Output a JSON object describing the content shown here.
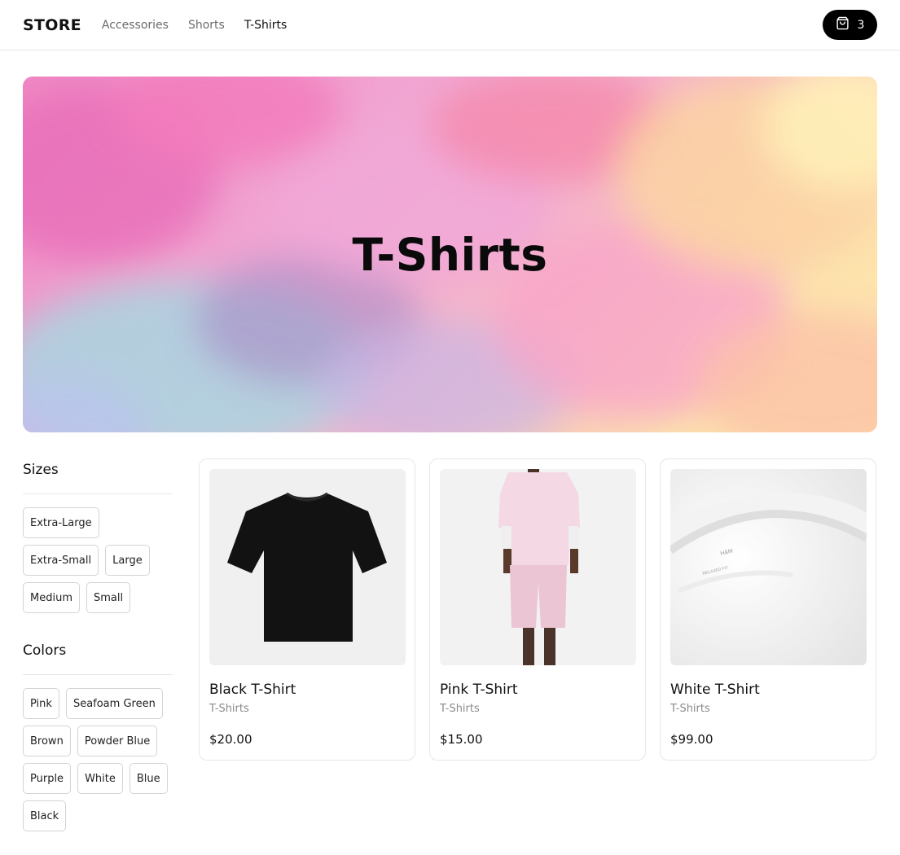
{
  "header": {
    "logo": "STORE",
    "nav": [
      {
        "label": "Accessories",
        "active": false
      },
      {
        "label": "Shorts",
        "active": false
      },
      {
        "label": "T-Shirts",
        "active": true
      }
    ],
    "cart_count": "3",
    "cart_icon": "shopping-bag-icon"
  },
  "hero": {
    "title": "T-Shirts",
    "colors": [
      "#f47ab7",
      "#e9a8d8",
      "#a7d3dd",
      "#f9c6a0",
      "#fde8b0",
      "#c89ad6"
    ]
  },
  "filters": {
    "sizes": {
      "title": "Sizes",
      "options": [
        "Extra-Large",
        "Extra-Small",
        "Large",
        "Medium",
        "Small"
      ]
    },
    "colors": {
      "title": "Colors",
      "options": [
        "Pink",
        "Seafoam Green",
        "Brown",
        "Powder Blue",
        "Purple",
        "White",
        "Blue",
        "Black"
      ]
    }
  },
  "products": [
    {
      "name": "Black T-Shirt",
      "category": "T-Shirts",
      "price": "$20.00",
      "image": "black-tshirt"
    },
    {
      "name": "Pink T-Shirt",
      "category": "T-Shirts",
      "price": "$15.00",
      "image": "pink-tshirt-model"
    },
    {
      "name": "White T-Shirt",
      "category": "T-Shirts",
      "price": "$99.00",
      "image": "white-tshirt-collar"
    }
  ]
}
